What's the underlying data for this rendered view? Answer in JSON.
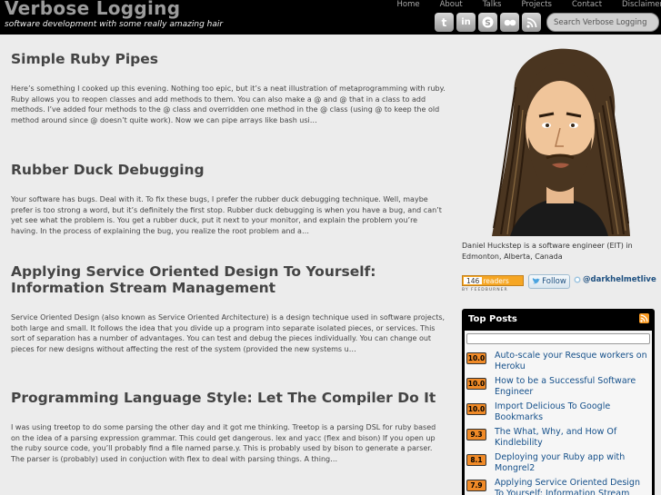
{
  "header": {
    "site_title": "Verbose Logging",
    "tagline": "software development with some really amazing hair",
    "nav": [
      "Home",
      "About",
      "Talks",
      "Projects",
      "Contact",
      "Disclaimer"
    ],
    "social": [
      {
        "icon": "twitter-icon",
        "glyph": "t"
      },
      {
        "icon": "linkedin-icon",
        "glyph": "in"
      },
      {
        "icon": "skype-icon",
        "glyph": "S"
      },
      {
        "icon": "flickr-icon",
        "glyph": "••"
      },
      {
        "icon": "rss-icon",
        "glyph": "◉"
      }
    ],
    "search_placeholder": "Search Verbose Logging"
  },
  "posts": [
    {
      "title": "Simple Ruby Pipes",
      "excerpt": "Here’s something I cooked up this evening. Nothing too epic, but it’s a neat illustration of metaprogramming with ruby. Ruby allows you to reopen classes and add methods to them. You can also make a @ and @ that in a class to add methods. I’ve added four methods to the @ class and overridden one method in the @ class (using @ to keep the old method around since @ doesn’t quite work). Now we can pipe arrays like bash usi…"
    },
    {
      "title": "Rubber Duck Debugging",
      "excerpt": "Your software has bugs. Deal with it. To fix these bugs, I prefer the rubber duck debugging technique. Well, maybe prefer is too strong a word, but it’s definitely the first stop. Rubber duck debugging is when you have a bug, and can’t yet see what the problem is. You get a rubber duck, put it next to your monitor, and explain the problem you’re having. In the process of explaining the bug, you realize the root problem and a…"
    },
    {
      "title": "Applying Service Oriented Design To Yourself: Information Stream Management",
      "excerpt": "Service Oriented Design (also known as Service Oriented Architecture) is a design technique used in software projects, both large and small. It follows the idea that you divide up a program into separate isolated pieces, or services. This sort of separation has a number of advantages. You can test and debug the pieces individually. You can change out pieces for new designs without affecting the rest of the system (provided the new systems u…"
    },
    {
      "title": "Programming Language Style: Let The Compiler Do It",
      "excerpt": "I was using treetop to do some parsing the other day and it got me thinking. Treetop is a parsing DSL for ruby based on the idea of a parsing expression grammar. This could get dangerous. lex and yacc (flex and bison) If you open up the ruby source code, you’ll probably find a file named parse.y. This is probably used by bison to generate a parser. The parser is (probably) used in conjuction with flex to deal with parsing things. A thing…"
    }
  ],
  "sidebar": {
    "avatar_icon": "author-avatar-icon",
    "bio": "Daniel Huckstep is a software engineer (EIT) in Edmonton, Alberta, Canada",
    "feed": {
      "count": "146",
      "label": "readers",
      "by": "BY FEEDBURNER"
    },
    "follow_label": "Follow",
    "twitter_handle": "@darkhelmetlive",
    "top_posts": {
      "title": "Top Posts",
      "items": [
        {
          "score": "10.0",
          "title": "Auto-scale your Resque workers on Heroku"
        },
        {
          "score": "10.0",
          "title": "How to be a Successful Software Engineer"
        },
        {
          "score": "10.0",
          "title": "Import Delicious To Google Bookmarks"
        },
        {
          "score": "9.3",
          "title": "The What, Why, and How Of Kindlebility"
        },
        {
          "score": "8.1",
          "title": "Deploying your Ruby app with Mongrel2"
        },
        {
          "score": "7.9",
          "title": "Applying Service Oriented Design To Yourself: Information Stream Management"
        }
      ]
    }
  },
  "colors": {
    "header_bg": "#000000",
    "page_bg": "#ececec",
    "link": "#15508a",
    "score_badge": "#f08a27",
    "feed_orange": "#f6a623"
  }
}
